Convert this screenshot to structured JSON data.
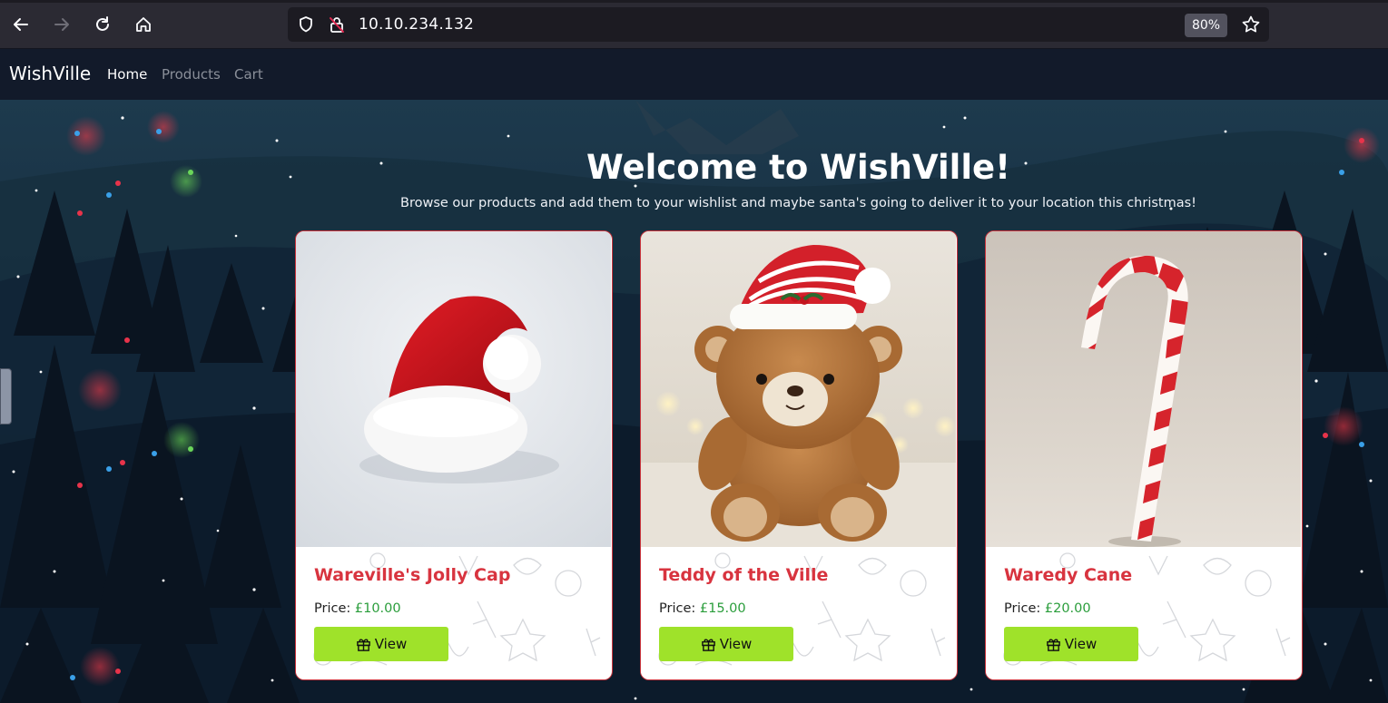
{
  "browser": {
    "url": "10.10.234.132",
    "zoom": "80%",
    "icons": [
      "back-arrow-icon",
      "forward-arrow-icon",
      "reload-icon",
      "home-icon",
      "shield-icon",
      "insecure-lock-icon",
      "bookmark-star-icon"
    ]
  },
  "site": {
    "brand": "WishVille",
    "nav": {
      "home": "Home",
      "products": "Products",
      "cart": "Cart"
    }
  },
  "hero": {
    "title": "Welcome to WishVille!",
    "subtitle": "Browse our products and add them to your wishlist and maybe santa's going to deliver it to your location this christmas!"
  },
  "products": [
    {
      "name": "Wareville's Jolly Cap",
      "price_label": "Price:",
      "price": "£10.00",
      "button": "View",
      "image": "santa-hat"
    },
    {
      "name": "Teddy of the Ville",
      "price_label": "Price:",
      "price": "£15.00",
      "button": "View",
      "image": "teddy-bear"
    },
    {
      "name": "Waredy Cane",
      "price_label": "Price:",
      "price": "£20.00",
      "button": "View",
      "image": "candy-cane"
    }
  ],
  "colors": {
    "accent_red": "#d8343f",
    "price_green": "#2a9d3b",
    "button_green": "#9fe22a",
    "nav_bg": "#121a2a"
  }
}
